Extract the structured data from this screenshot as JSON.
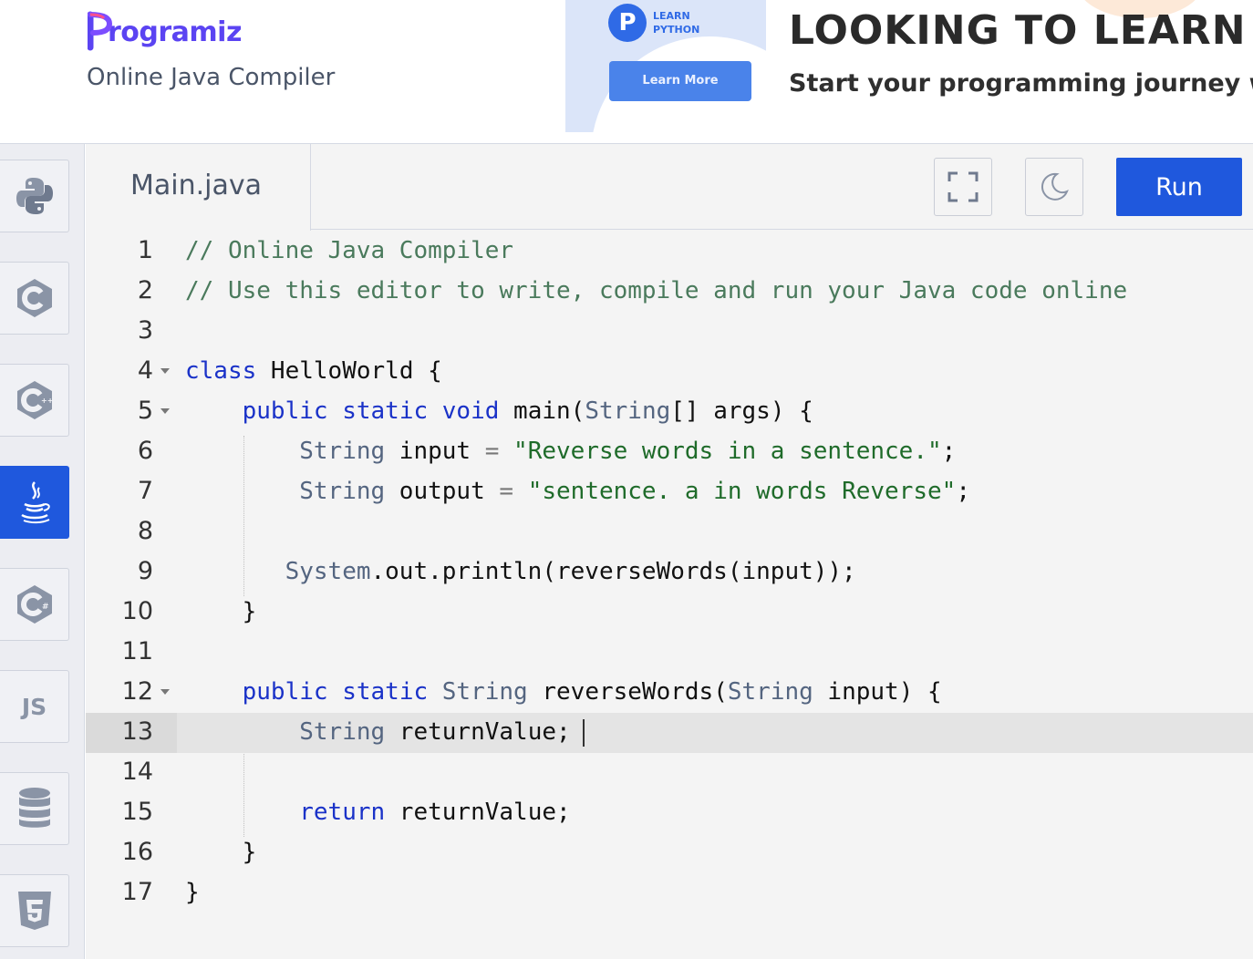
{
  "header": {
    "logo_text": "rogramiz",
    "logo_initial": "P",
    "subtitle": "Online Java Compiler"
  },
  "ad": {
    "badge": "P",
    "learn_line1": "LEARN",
    "learn_line2": "PYTHON",
    "button": "Learn More",
    "headline": "LOOKING TO LEARN",
    "subline": "Start your programming journey wi"
  },
  "sidebar": {
    "items": [
      {
        "name": "python",
        "icon": "python-icon",
        "active": false
      },
      {
        "name": "c",
        "icon": "c-icon",
        "active": false
      },
      {
        "name": "cpp",
        "icon": "cpp-icon",
        "active": false
      },
      {
        "name": "java",
        "icon": "java-icon",
        "active": true
      },
      {
        "name": "csharp",
        "icon": "csharp-icon",
        "active": false
      },
      {
        "name": "js",
        "label": "JS",
        "icon": "js-icon",
        "active": false
      },
      {
        "name": "sql",
        "icon": "database-icon",
        "active": false
      },
      {
        "name": "html",
        "icon": "html5-icon",
        "active": false
      }
    ]
  },
  "editor": {
    "tab_name": "Main.java",
    "fullscreen_icon": "fullscreen-icon",
    "theme_icon": "moon-icon",
    "run_label": "Run",
    "active_line": 13
  },
  "code_lines": [
    {
      "n": "1",
      "text": "// Online Java Compiler"
    },
    {
      "n": "2",
      "text": "// Use this editor to write, compile and run your Java code online"
    },
    {
      "n": "3",
      "text": ""
    },
    {
      "n": "4",
      "text": "class HelloWorld {"
    },
    {
      "n": "5",
      "text": "    public static void main(String[] args) {"
    },
    {
      "n": "6",
      "text": "        String input = \"Reverse words in a sentence.\";"
    },
    {
      "n": "7",
      "text": "        String output = \"sentence. a in words Reverse\";"
    },
    {
      "n": "8",
      "text": ""
    },
    {
      "n": "9",
      "text": "       System.out.println(reverseWords(input));"
    },
    {
      "n": "10",
      "text": "    }"
    },
    {
      "n": "11",
      "text": ""
    },
    {
      "n": "12",
      "text": "    public static String reverseWords(String input) {"
    },
    {
      "n": "13",
      "text": "        String returnValue;"
    },
    {
      "n": "14",
      "text": ""
    },
    {
      "n": "15",
      "text": "        return returnValue;"
    },
    {
      "n": "16",
      "text": "    }"
    },
    {
      "n": "17",
      "text": "}"
    }
  ],
  "colors": {
    "accent": "#1f58dd",
    "brand": "#5b44f2",
    "comment": "#4a7a5c",
    "keyword": "#1a32c8",
    "type": "#546580",
    "string": "#1f6b2a"
  }
}
